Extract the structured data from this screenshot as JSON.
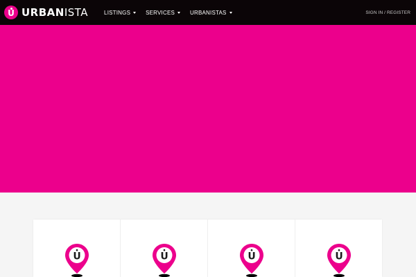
{
  "brand": {
    "prefix": "URBAN",
    "suffix": "ISTA",
    "logo_icon": "urbanista-u-logo-icon"
  },
  "nav": {
    "items": [
      {
        "label": "LISTINGS"
      },
      {
        "label": "SERVICES"
      },
      {
        "label": "URBANISTAS"
      }
    ]
  },
  "auth": {
    "signin": "SIGN IN",
    "separator": " / ",
    "register": "REGISTER"
  },
  "colors": {
    "brand_pink": "#ec008c",
    "navbar_bg": "#0b0507",
    "page_bg": "#f5f5f5"
  },
  "cards": [
    {
      "icon": "map-pin-u-icon"
    },
    {
      "icon": "map-pin-u-icon"
    },
    {
      "icon": "map-pin-u-icon"
    },
    {
      "icon": "map-pin-u-icon"
    }
  ]
}
